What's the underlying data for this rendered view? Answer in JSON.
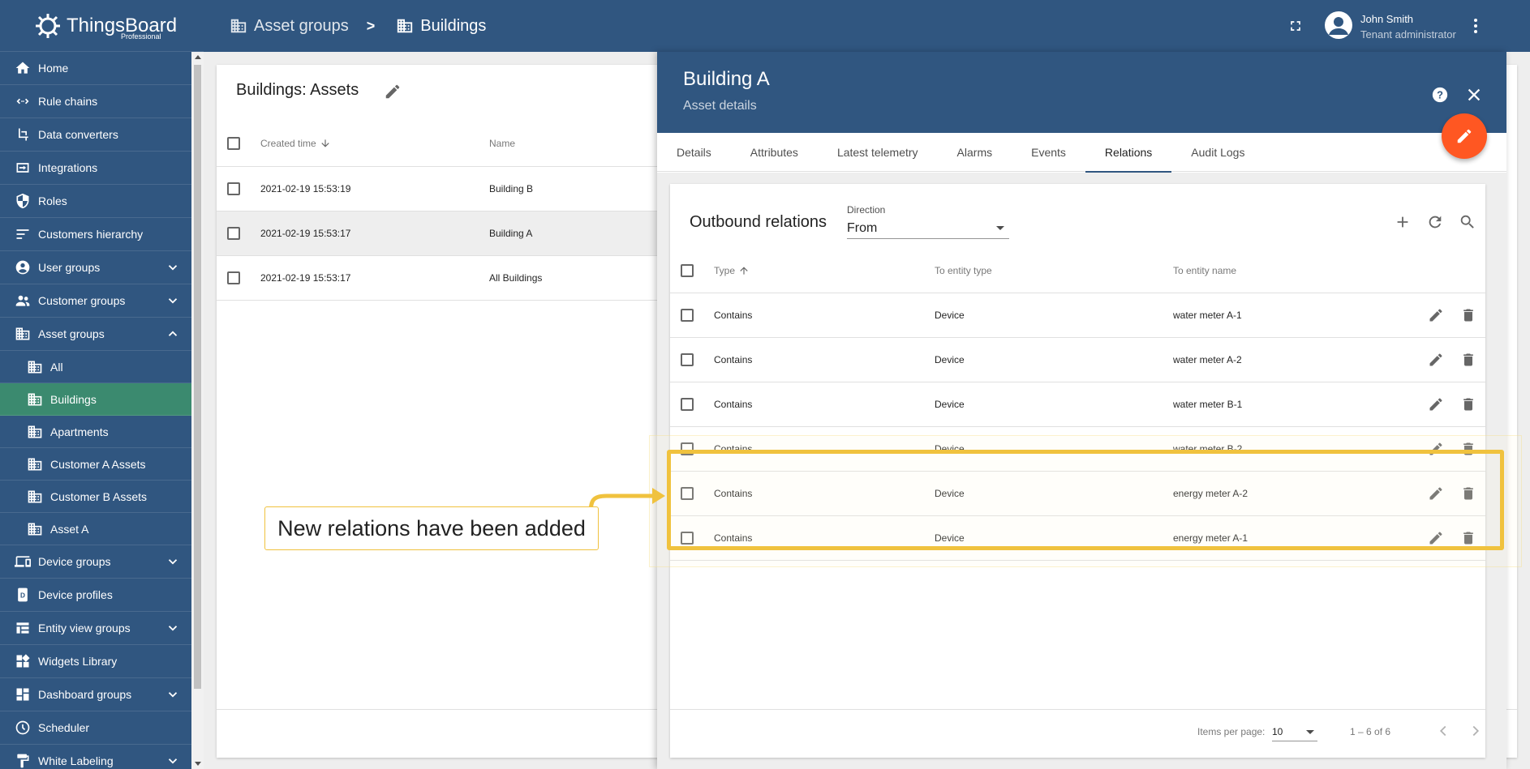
{
  "app": {
    "logo_text": "ThingsBoard",
    "logo_sub": "Professional",
    "brand_color": "#305680",
    "active_color": "#3b8a6f",
    "accent_color": "#ff5722",
    "annotation_color": "#f0c23e"
  },
  "sidebar": {
    "items": [
      {
        "label": "Home",
        "icon": "home-icon",
        "chevron": ""
      },
      {
        "label": "Rule chains",
        "icon": "rule-chains-icon",
        "chevron": ""
      },
      {
        "label": "Data converters",
        "icon": "data-converters-icon",
        "chevron": ""
      },
      {
        "label": "Integrations",
        "icon": "integrations-icon",
        "chevron": ""
      },
      {
        "label": "Roles",
        "icon": "shield-icon",
        "chevron": ""
      },
      {
        "label": "Customers hierarchy",
        "icon": "hierarchy-icon",
        "chevron": ""
      },
      {
        "label": "User groups",
        "icon": "account-circle-icon",
        "chevron": "down"
      },
      {
        "label": "Customer groups",
        "icon": "people-icon",
        "chevron": "down"
      },
      {
        "label": "Asset groups",
        "icon": "building-icon",
        "chevron": "up"
      },
      {
        "label": "All",
        "icon": "building-icon",
        "sub": true
      },
      {
        "label": "Buildings",
        "icon": "building-icon",
        "sub": true,
        "active": true
      },
      {
        "label": "Apartments",
        "icon": "building-icon",
        "sub": true
      },
      {
        "label": "Customer A Assets",
        "icon": "building-icon",
        "sub": true
      },
      {
        "label": "Customer B Assets",
        "icon": "building-icon",
        "sub": true
      },
      {
        "label": "Asset A",
        "icon": "building-icon",
        "sub": true
      },
      {
        "label": "Device groups",
        "icon": "devices-icon",
        "chevron": "down"
      },
      {
        "label": "Device profiles",
        "icon": "device-profile-icon",
        "chevron": ""
      },
      {
        "label": "Entity view groups",
        "icon": "entity-view-icon",
        "chevron": "down"
      },
      {
        "label": "Widgets Library",
        "icon": "widgets-icon",
        "chevron": ""
      },
      {
        "label": "Dashboard groups",
        "icon": "dashboard-icon",
        "chevron": "down"
      },
      {
        "label": "Scheduler",
        "icon": "clock-icon",
        "chevron": ""
      },
      {
        "label": "White Labeling",
        "icon": "format-paint-icon",
        "chevron": "down"
      }
    ]
  },
  "topbar": {
    "breadcrumb": [
      "Asset groups",
      "Buildings"
    ],
    "separator": ">",
    "user_name": "John Smith",
    "user_role": "Tenant administrator"
  },
  "assets_table": {
    "title": "Buildings: Assets",
    "columns": [
      "Created time",
      "Name"
    ],
    "rows": [
      {
        "created": "2021-02-19 15:53:19",
        "name": "Building B",
        "selected": false
      },
      {
        "created": "2021-02-19 15:53:17",
        "name": "Building A",
        "selected": true
      },
      {
        "created": "2021-02-19 15:53:17",
        "name": "All Buildings",
        "selected": false
      }
    ]
  },
  "drawer": {
    "title": "Building A",
    "subtitle": "Asset details",
    "tabs": [
      "Details",
      "Attributes",
      "Latest telemetry",
      "Alarms",
      "Events",
      "Relations",
      "Audit Logs"
    ],
    "active_tab": "Relations",
    "relations": {
      "title": "Outbound relations",
      "direction_label": "Direction",
      "direction_value": "From",
      "columns": [
        "Type",
        "To entity type",
        "To entity name"
      ],
      "rows": [
        {
          "type": "Contains",
          "entity_type": "Device",
          "entity_name": "water meter A-1"
        },
        {
          "type": "Contains",
          "entity_type": "Device",
          "entity_name": "water meter A-2"
        },
        {
          "type": "Contains",
          "entity_type": "Device",
          "entity_name": "water meter B-1"
        },
        {
          "type": "Contains",
          "entity_type": "Device",
          "entity_name": "water meter B-2"
        },
        {
          "type": "Contains",
          "entity_type": "Device",
          "entity_name": "energy meter A-2"
        },
        {
          "type": "Contains",
          "entity_type": "Device",
          "entity_name": "energy meter A-1"
        }
      ],
      "items_per_page_label": "Items per page:",
      "items_per_page": "10",
      "range": "1 – 6 of 6"
    }
  },
  "annotation": {
    "callout": "New relations have been added"
  }
}
